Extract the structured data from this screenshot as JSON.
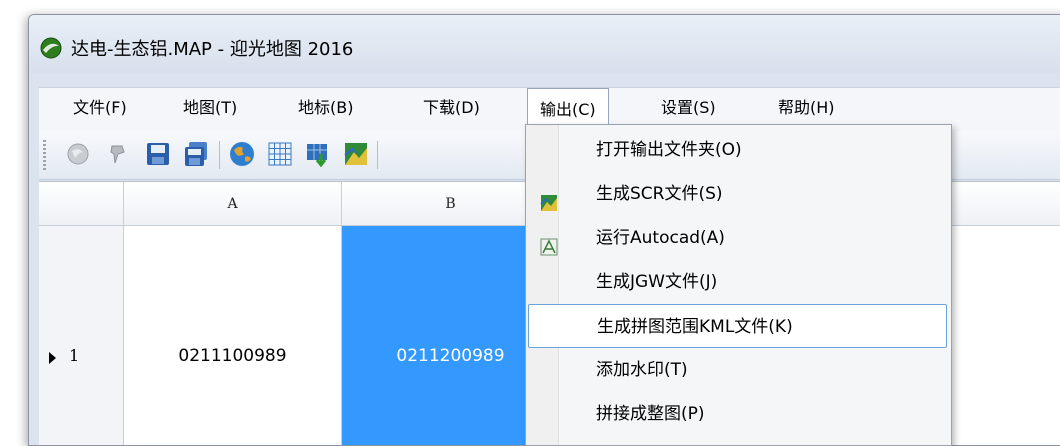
{
  "window": {
    "title": "达电-生态铝.MAP - 迎光地图 2016"
  },
  "menubar": {
    "items": [
      {
        "label": "文件(F)"
      },
      {
        "label": "地图(T)"
      },
      {
        "label": "地标(B)"
      },
      {
        "label": "下载(D)"
      },
      {
        "label": "输出(C)"
      },
      {
        "label": "设置(S)"
      },
      {
        "label": "帮助(H)"
      }
    ],
    "active_index": 4
  },
  "toolbar": {
    "buttons": [
      "globe-gray-icon",
      "pin-gray-icon",
      "save-icon",
      "save-as-icon",
      "earth-globe-icon",
      "grid-icon",
      "export-download-icon",
      "map-image-icon"
    ]
  },
  "grid": {
    "columns": [
      "",
      "A",
      "B"
    ],
    "rows": [
      {
        "num": "1",
        "cells": [
          "0211100989",
          "0211200989"
        ]
      }
    ],
    "selected_cell_color": "#3399ff"
  },
  "dropdown": {
    "items": [
      {
        "label": "打开输出文件夹(O)",
        "icon": null
      },
      {
        "label": "生成SCR文件(S)",
        "icon": "scr-map-icon"
      },
      {
        "label": "运行Autocad(A)",
        "icon": "autocad-icon"
      },
      {
        "label": "生成JGW文件(J)",
        "icon": null
      },
      {
        "label": "生成拼图范围KML文件(K)",
        "icon": null,
        "hover": true
      },
      {
        "label": "添加水印(T)",
        "icon": null
      },
      {
        "label": "拼接成整图(P)",
        "icon": null
      }
    ]
  }
}
